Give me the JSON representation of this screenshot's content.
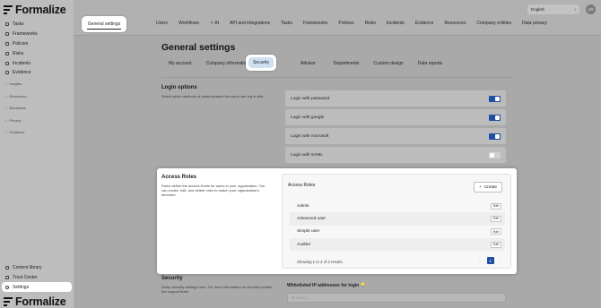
{
  "app": {
    "name": "Formalize"
  },
  "sidebar": {
    "items": [
      {
        "label": "Tasks",
        "icon": "tasks-icon"
      },
      {
        "label": "Frameworks",
        "icon": "frameworks-icon"
      },
      {
        "label": "Policies",
        "icon": "policies-icon"
      },
      {
        "label": "Risks",
        "icon": "risks-icon"
      },
      {
        "label": "Incidents",
        "icon": "incidents-icon"
      },
      {
        "label": "Evidence",
        "icon": "evidence-icon"
      }
    ],
    "groups": [
      "Insights",
      "Resources",
      "Workflows",
      "Privacy",
      "Guidance"
    ],
    "bottom": [
      {
        "label": "Content library"
      },
      {
        "label": "Trust Center"
      },
      {
        "label": "Settings",
        "active": true
      }
    ]
  },
  "topnav": {
    "active": "General settings",
    "items": [
      "Users",
      "Workflows",
      "AI",
      "API and integrations",
      "Tasks",
      "Frameworks",
      "Policies",
      "Risks",
      "Incidents",
      "Evidence",
      "Resources",
      "Company entities",
      "Data privacy"
    ],
    "language": "English",
    "avatar_initials": "LR"
  },
  "page": {
    "title": "General settings",
    "subtabs": [
      "My account",
      "Company information",
      "Security",
      "Advisor",
      "Departments",
      "Custom design",
      "Data reports"
    ],
    "active_subtab": "Security"
  },
  "login_options": {
    "title": "Login options",
    "description": "Select which methods of authentication the users can log in with.",
    "rows": [
      {
        "label": "Login with password",
        "on": true
      },
      {
        "label": "Login with google",
        "on": true
      },
      {
        "label": "Login with microsoft",
        "on": true
      },
      {
        "label": "Login with SAML",
        "on": false
      }
    ]
  },
  "access_roles": {
    "title": "Access Roles",
    "description": "Roles define the access levels for users in your organization. You can create, edit, and delete roles to match your organization's structure.",
    "panel_title": "Access Roles",
    "create_label": "Create",
    "edit_label": "Edit",
    "roles": [
      "Admin",
      "Advanced user",
      "Simple user",
      "Auditor"
    ],
    "pagination_text": "Showing 1 to 4 of 4 results",
    "current_page": "1"
  },
  "security": {
    "title": "Security",
    "description": "Setup security settings here. For more information on security contact the support team.",
    "ip_title": "Whitelisted IP addresses for login",
    "ip_placeholder": "IP 0.0.0.0"
  },
  "colors": {
    "accent": "#1f4fa3"
  }
}
